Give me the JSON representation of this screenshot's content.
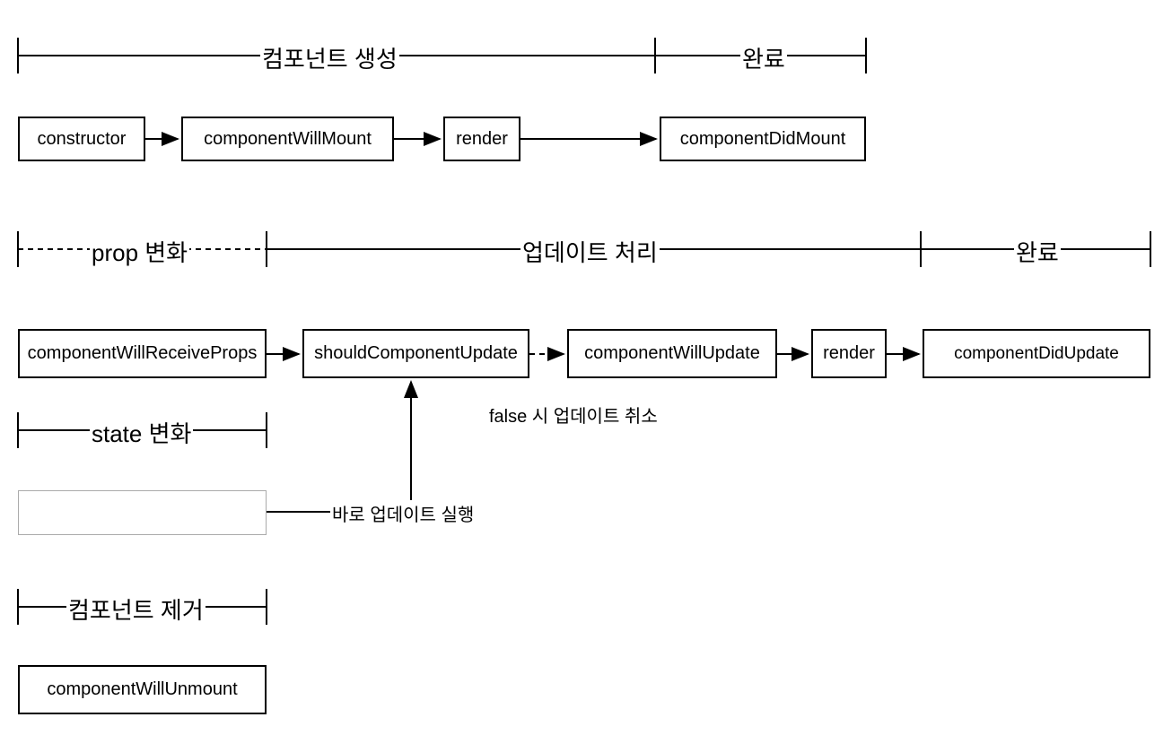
{
  "sections": {
    "creation": "컴포넌트 생성",
    "done1": "완료",
    "propChange": "prop 변화",
    "updateProcess": "업데이트 처리",
    "done2": "완료",
    "stateChange": "state 변화",
    "removal": "컴포넌트 제거"
  },
  "boxes": {
    "constructor": "constructor",
    "componentWillMount": "componentWillMount",
    "render1": "render",
    "componentDidMount": "componentDidMount",
    "componentWillReceiveProps": "componentWillReceiveProps",
    "shouldComponentUpdate": "shouldComponentUpdate",
    "componentWillUpdate": "componentWillUpdate",
    "render2": "render",
    "componentDidUpdate": "componentDidUpdate",
    "componentWillUnmount": "componentWillUnmount"
  },
  "annotations": {
    "falseCancel": "false 시 업데이트 취소",
    "immediateUpdate": "바로 업데이트 실행"
  }
}
